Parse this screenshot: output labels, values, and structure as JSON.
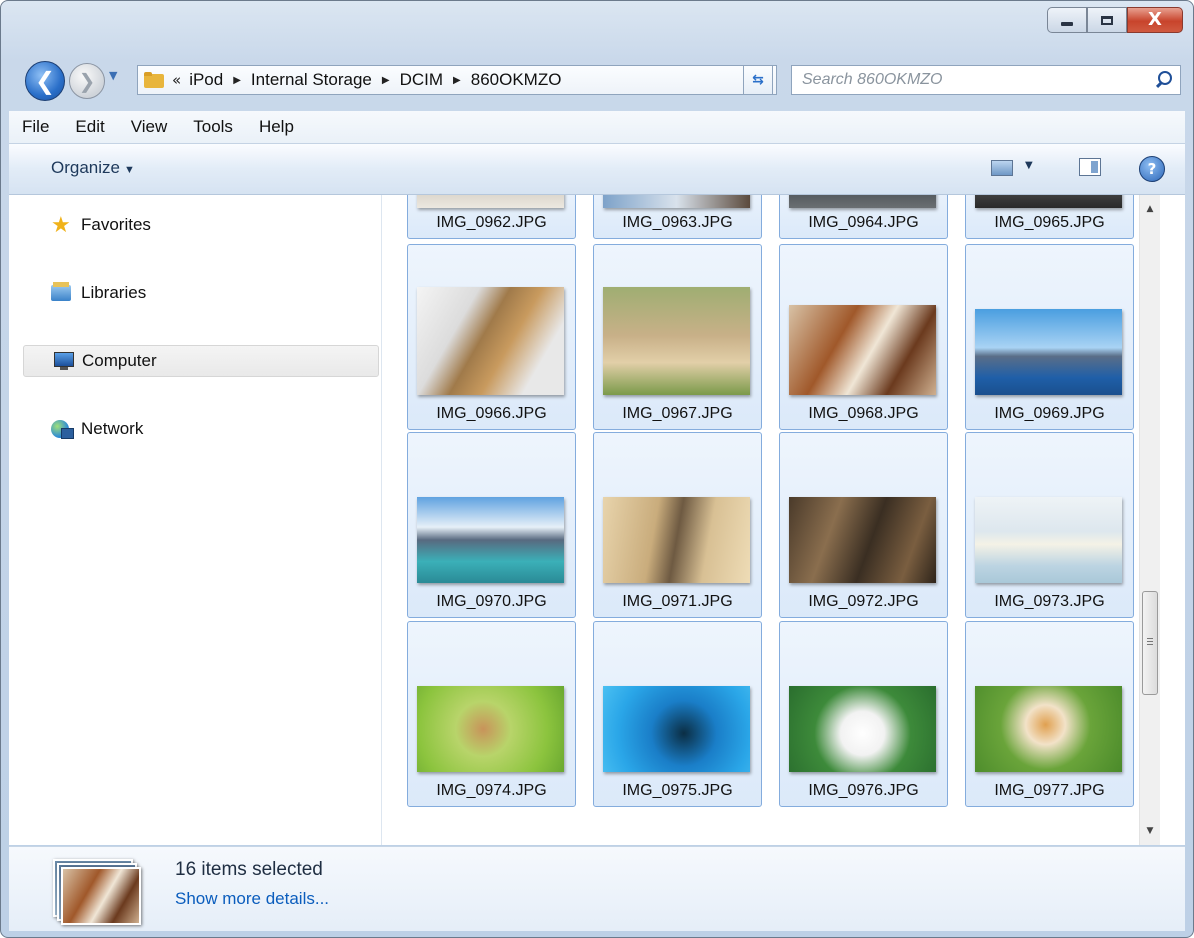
{
  "window": {
    "minimize": "minimize",
    "maximize": "maximize",
    "close": "X"
  },
  "navigation": {
    "back_glyph": "❮",
    "forward_glyph": "❯",
    "breadcrumb_overflow": "«",
    "breadcrumb": [
      "iPod",
      "Internal Storage",
      "DCIM",
      "860OKMZO"
    ],
    "separator": "▶",
    "refresh_glyph": "⇆"
  },
  "search": {
    "placeholder": "Search 860OKMZO",
    "value": ""
  },
  "menu": [
    "File",
    "Edit",
    "View",
    "Tools",
    "Help"
  ],
  "toolbar": {
    "organize": "Organize",
    "dropdown_glyph": "▼",
    "help_glyph": "?"
  },
  "sidebar": {
    "items": [
      {
        "label": "Favorites",
        "icon": "star-icon"
      },
      {
        "label": "Libraries",
        "icon": "libraries-icon"
      },
      {
        "label": "Computer",
        "icon": "computer-icon",
        "selected": true
      },
      {
        "label": "Network",
        "icon": "network-icon"
      }
    ]
  },
  "files": [
    {
      "name": "IMG_0962.JPG",
      "selected": true
    },
    {
      "name": "IMG_0963.JPG",
      "selected": true
    },
    {
      "name": "IMG_0964.JPG",
      "selected": true
    },
    {
      "name": "IMG_0965.JPG",
      "selected": true
    },
    {
      "name": "IMG_0966.JPG",
      "selected": true
    },
    {
      "name": "IMG_0967.JPG",
      "selected": true
    },
    {
      "name": "IMG_0968.JPG",
      "selected": true
    },
    {
      "name": "IMG_0969.JPG",
      "selected": true
    },
    {
      "name": "IMG_0970.JPG",
      "selected": true
    },
    {
      "name": "IMG_0971.JPG",
      "selected": true
    },
    {
      "name": "IMG_0972.JPG",
      "selected": true
    },
    {
      "name": "IMG_0973.JPG",
      "selected": true
    },
    {
      "name": "IMG_0974.JPG",
      "selected": true
    },
    {
      "name": "IMG_0975.JPG",
      "selected": true
    },
    {
      "name": "IMG_0976.JPG",
      "selected": true
    },
    {
      "name": "IMG_0977.JPG",
      "selected": true
    }
  ],
  "details": {
    "count": "16 items selected",
    "more_link": "Show more details..."
  },
  "colors": {
    "selection_border": "#84acdd",
    "selection_fill": "#dbe9f9",
    "link": "#0b5dbd"
  }
}
